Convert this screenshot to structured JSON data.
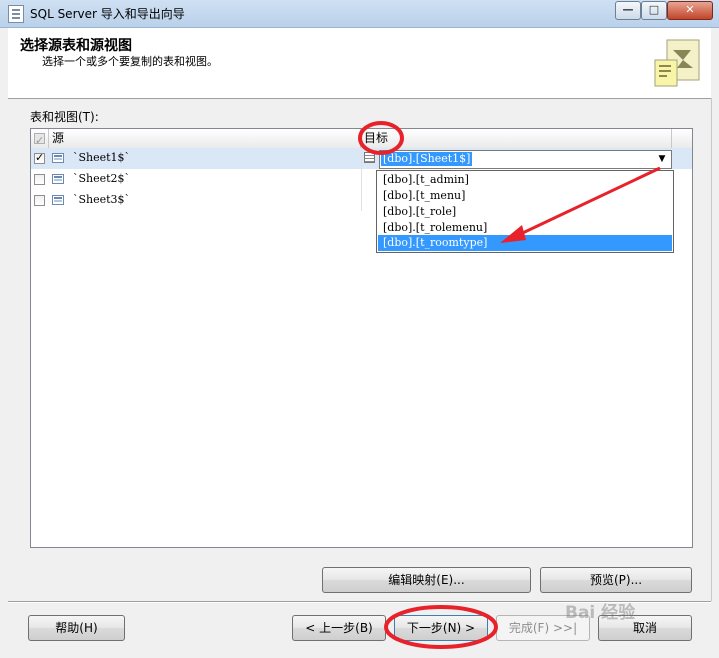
{
  "window": {
    "title": "SQL Server 导入和导出向导",
    "minimize": "—",
    "maximize": "□",
    "close": "✕"
  },
  "header": {
    "title": "选择源表和源视图",
    "subtitle": "选择一个或多个要复制的表和视图。"
  },
  "list_label": "表和视图(T):",
  "grid": {
    "columns": {
      "source": "源",
      "destination": "目标"
    },
    "rows": [
      {
        "checked": true,
        "source": "`Sheet1$`",
        "destination": "[dbo].[Sheet1$]"
      },
      {
        "checked": false,
        "source": "`Sheet2$`",
        "destination": ""
      },
      {
        "checked": false,
        "source": "`Sheet3$`",
        "destination": ""
      }
    ]
  },
  "dropdown": {
    "items": [
      "[dbo].[t_admin]",
      "[dbo].[t_menu]",
      "[dbo].[t_role]",
      "[dbo].[t_rolemenu]",
      "[dbo].[t_roomtype]"
    ],
    "highlighted": "[dbo].[t_roomtype]"
  },
  "buttons": {
    "edit_mappings": "编辑映射(E)...",
    "preview": "预览(P)...",
    "help": "帮助(H)",
    "back": "< 上一步(B)",
    "next": "下一步(N) >",
    "finish": "完成(F) >>|",
    "cancel": "取消"
  },
  "watermark": "Bai 经验",
  "colors": {
    "selection": "#3399ff",
    "annotation": "#e8222a"
  }
}
